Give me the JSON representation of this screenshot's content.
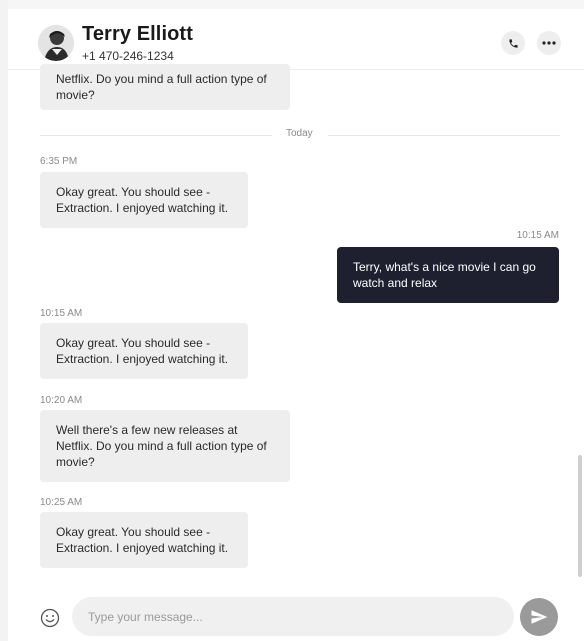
{
  "contact": {
    "name": "Terry Elliott",
    "phone": "+1 470-246-1234"
  },
  "header": {
    "call_icon": "phone-icon",
    "more_icon": "more-dots-icon"
  },
  "divider": {
    "label": "Today"
  },
  "messages": [
    {
      "direction": "in",
      "lines": [
        "Netflix. Do you mind a full action type of",
        "movie?"
      ],
      "time": ""
    },
    {
      "direction": "in",
      "lines": [
        "Okay great. You should see -",
        "Extraction. I enjoyed watching it."
      ],
      "time": "6:35 PM"
    },
    {
      "direction": "out",
      "lines": [
        "Terry, what's a nice movie I can go",
        "watch and relax"
      ],
      "time": "10:15 AM"
    },
    {
      "direction": "in",
      "lines": [
        "Okay great. You should see -",
        "Extraction. I enjoyed watching it."
      ],
      "time": "10:15 AM"
    },
    {
      "direction": "in",
      "lines": [
        "Well there's a few new releases at",
        "Netflix. Do you mind a full action type of",
        "movie?"
      ],
      "time": "10:20 AM"
    },
    {
      "direction": "in",
      "lines": [
        "Okay great. You should see -",
        "Extraction. I enjoyed watching it."
      ],
      "time": "10:25 AM"
    }
  ],
  "composer": {
    "placeholder": "Type your message...",
    "value": "",
    "emoji_icon": "smiley-icon",
    "send_icon": "send-arrow-icon"
  },
  "colors": {
    "outgoing_bubble": "#1e2030",
    "incoming_bubble": "#eeeeee",
    "send_button": "#9a9a9a"
  }
}
